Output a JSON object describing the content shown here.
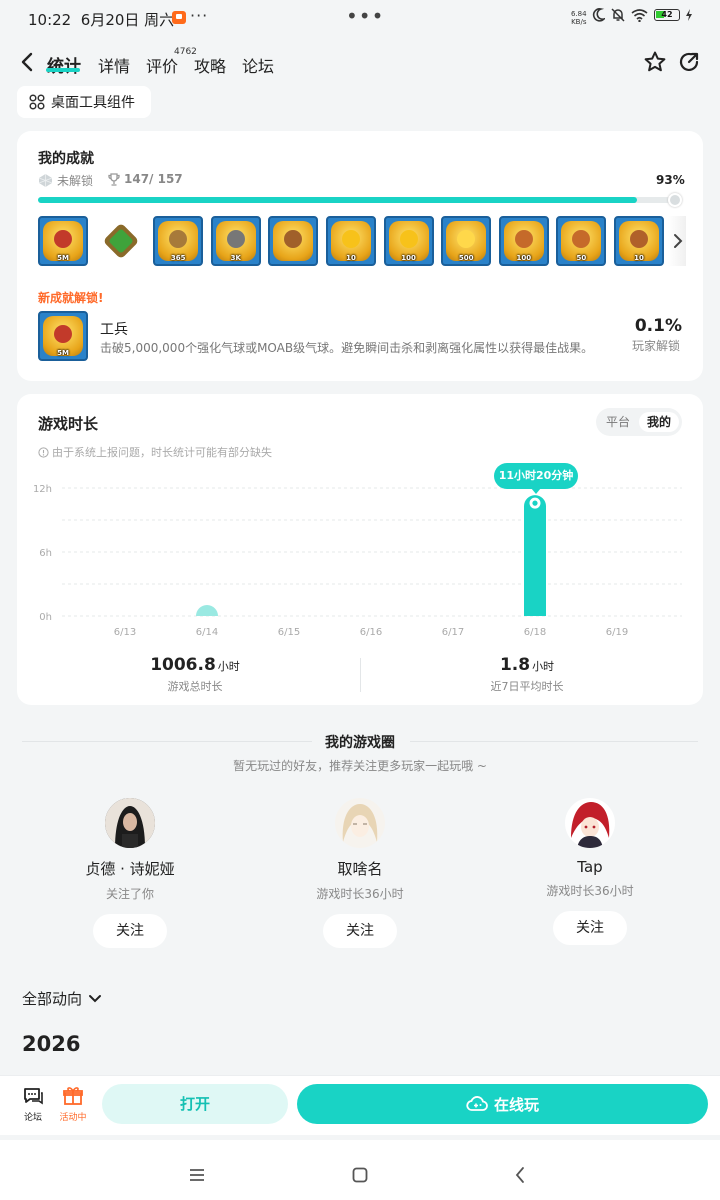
{
  "status_bar": {
    "time": "10:22",
    "date": "6月20日 周六",
    "more_dots": "···",
    "center_dots": "•••",
    "net_speed_value": "6.84",
    "net_speed_unit": "KB/s",
    "battery": "42"
  },
  "nav": {
    "tabs": [
      {
        "label": "统计",
        "active": true
      },
      {
        "label": "详情",
        "active": false
      },
      {
        "label": "评价",
        "active": false
      },
      {
        "label": "攻略",
        "active": false
      },
      {
        "label": "论坛",
        "active": false
      }
    ],
    "review_count": "4762"
  },
  "widget_button": "桌面工具组件",
  "achievements": {
    "title": "我的成就",
    "locked_label": "未解锁",
    "count": "147/ 157",
    "percent_text": "93%",
    "progress": 0.93,
    "badges": [
      {
        "label": "5M",
        "core": "#c23a2a"
      },
      {
        "label": "",
        "plain": true
      },
      {
        "label": "365",
        "core": "#a77a3a"
      },
      {
        "label": "3K",
        "core": "#777777"
      },
      {
        "label": "",
        "core": "#a0602a"
      },
      {
        "label": "10",
        "core": "#f7c21a"
      },
      {
        "label": "100",
        "core": "#f7c21a"
      },
      {
        "label": "500",
        "core": "#ffd84a"
      },
      {
        "label": "100",
        "core": "#c56a2a"
      },
      {
        "label": "50",
        "core": "#c56a2a"
      },
      {
        "label": "10",
        "core": "#b0602a"
      }
    ],
    "new_unlock_label": "新成就解锁!",
    "new_unlock": {
      "name": "工兵",
      "description": "击破5,000,000个强化气球或MOAB级气球。避免瞬间击杀和剥离强化属性以获得最佳战果。",
      "badge_label": "5M",
      "percent": "0.1%",
      "percent_label": "玩家解锁"
    }
  },
  "playtime": {
    "title": "游戏时长",
    "toggle": [
      "平台",
      "我的"
    ],
    "note": "由于系统上报问题，时长统计可能有部分缺失",
    "tooltip": "11小时20分钟",
    "total_value": "1006.8",
    "total_unit": "小时",
    "total_label": "游戏总时长",
    "avg_value": "1.8",
    "avg_unit": "小时",
    "avg_label": "近7日平均时长"
  },
  "chart_data": {
    "type": "bar",
    "categories": [
      "6/13",
      "6/14",
      "6/15",
      "6/16",
      "6/17",
      "6/18",
      "6/19"
    ],
    "values": [
      0,
      0.2,
      0,
      0,
      0,
      11.33,
      0
    ],
    "yticks": [
      "12h",
      "6h",
      "0h"
    ],
    "ylim": [
      0,
      12
    ],
    "grid": true,
    "highlight_index": 5,
    "color": "#19d3c5"
  },
  "game_circle": {
    "title": "我的游戏圈",
    "subtitle": "暂无玩过的好友，推荐关注更多玩家一起玩哦 ~",
    "friends": [
      {
        "name": "贞德 · 诗妮娅",
        "sub": "关注了你",
        "button": "关注"
      },
      {
        "name": "取啥名",
        "sub": "游戏时长36小时",
        "button": "关注"
      },
      {
        "name": "Tap",
        "sub": "游戏时长36小时",
        "button": "关注"
      }
    ]
  },
  "feed": {
    "filter": "全部动向",
    "year": "2026"
  },
  "bottom_bar": {
    "forum": "论坛",
    "event": "活动中",
    "open": "打开",
    "cloud_play": "在线玩"
  },
  "colors": {
    "accent": "#19d3c5",
    "orange": "#ff6a2a"
  }
}
